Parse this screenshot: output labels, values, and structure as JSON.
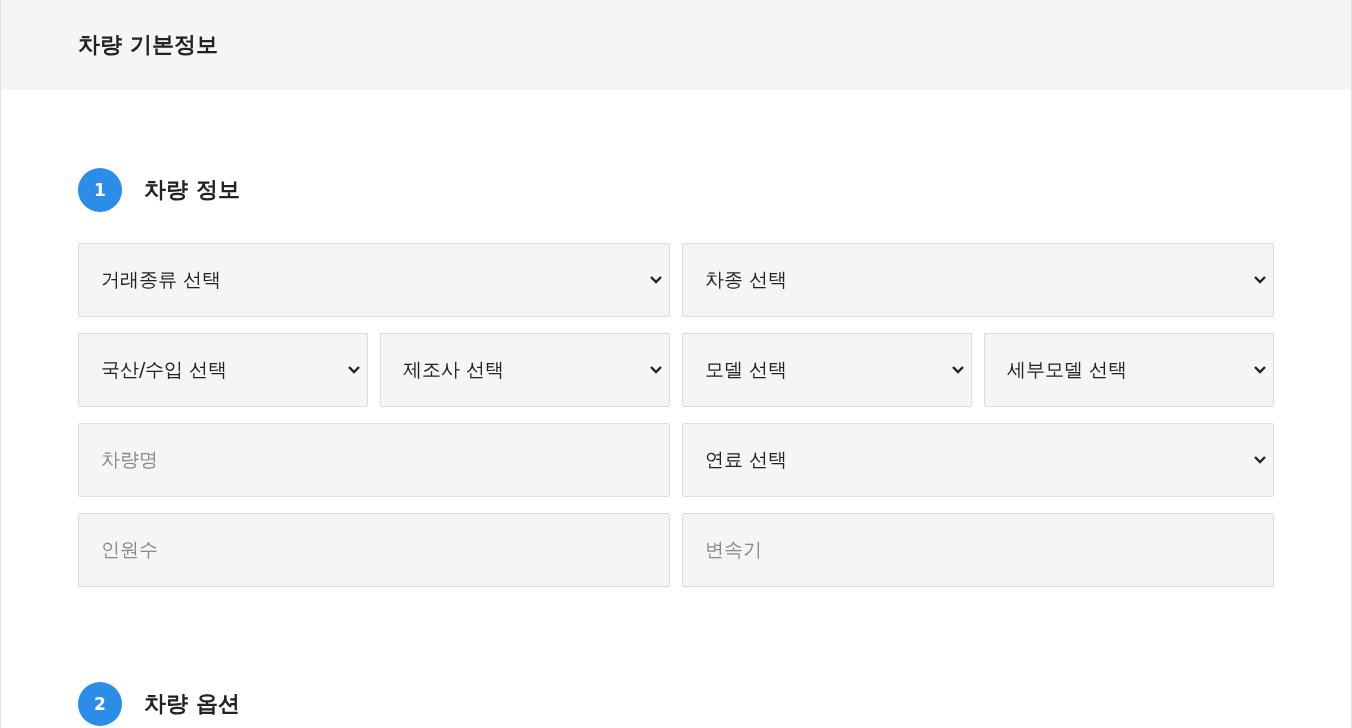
{
  "header": {
    "title": "차량 기본정보"
  },
  "sections": [
    {
      "number": "1",
      "title": "차량 정보",
      "rows": [
        [
          {
            "kind": "select",
            "value": "거래종류 선택"
          },
          {
            "kind": "select",
            "value": "차종 선택"
          }
        ],
        [
          {
            "kind": "select",
            "value": "국산/수입 선택"
          },
          {
            "kind": "select",
            "value": "제조사 선택"
          },
          {
            "kind": "select",
            "value": "모델 선택"
          },
          {
            "kind": "select",
            "value": "세부모델 선택"
          }
        ],
        [
          {
            "kind": "input",
            "placeholder": "차량명"
          },
          {
            "kind": "select",
            "value": "연료 선택"
          }
        ],
        [
          {
            "kind": "input",
            "placeholder": "인원수"
          },
          {
            "kind": "input",
            "placeholder": "변속기"
          }
        ]
      ]
    },
    {
      "number": "2",
      "title": "차량 옵션"
    }
  ]
}
